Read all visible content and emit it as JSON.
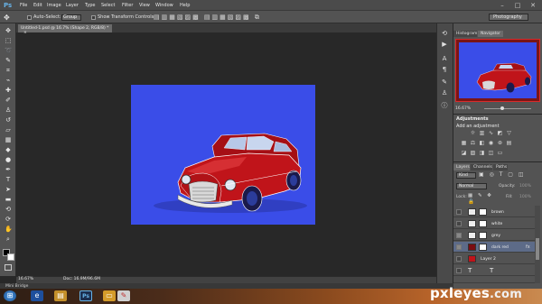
{
  "app": {
    "logo": "Ps"
  },
  "menu": [
    "File",
    "Edit",
    "Image",
    "Layer",
    "Type",
    "Select",
    "Filter",
    "View",
    "Window",
    "Help"
  ],
  "window_controls": {
    "minimize": "–",
    "maximize": "□",
    "close": "✕"
  },
  "options": {
    "auto_select_label": "Auto-Select:",
    "auto_select_value": "Group",
    "show_transform_label": "Show Transform Controls",
    "workspace": "Photography"
  },
  "document": {
    "tab_title": "Untitled-1.psd @ 16.7% (Shape 2, RGB/8) *",
    "tab_close": "×"
  },
  "status": {
    "zoom": "16.67%",
    "doc_size": "Doc: 16.9M/96.6M"
  },
  "mini_bridge": "Mini Bridge",
  "navigator": {
    "tabs": [
      "Histogram",
      "Navigator"
    ],
    "zoom": "16.67%"
  },
  "adjustments": {
    "title": "Adjustments",
    "hint": "Add an adjustment"
  },
  "layers": {
    "tabs": [
      "Layers",
      "Channels",
      "Paths"
    ],
    "kind": "Kind",
    "blend_mode": "Normal",
    "opacity_label": "Opacity:",
    "opacity_value": "100%",
    "lock_label": "Lock:",
    "fill_label": "Fill:",
    "fill_value": "100%",
    "items": [
      {
        "name": "brown"
      },
      {
        "name": "white"
      },
      {
        "name": "grey"
      },
      {
        "name": "dark red"
      },
      {
        "name": "Layer 2"
      },
      {
        "name": ""
      },
      {
        "name": ""
      }
    ]
  },
  "colors": {
    "canvas_bg": "#3a4de8",
    "car_body": "#c0141a",
    "accent": "#4b84d6"
  },
  "taskbar": {
    "icons": [
      "windows-start-icon",
      "internet-explorer-icon",
      "file-explorer-icon",
      "photoshop-icon",
      "folder-icon",
      "paint-icon"
    ]
  },
  "watermark": {
    "brand": "pxleyes",
    "tld": ".com"
  }
}
